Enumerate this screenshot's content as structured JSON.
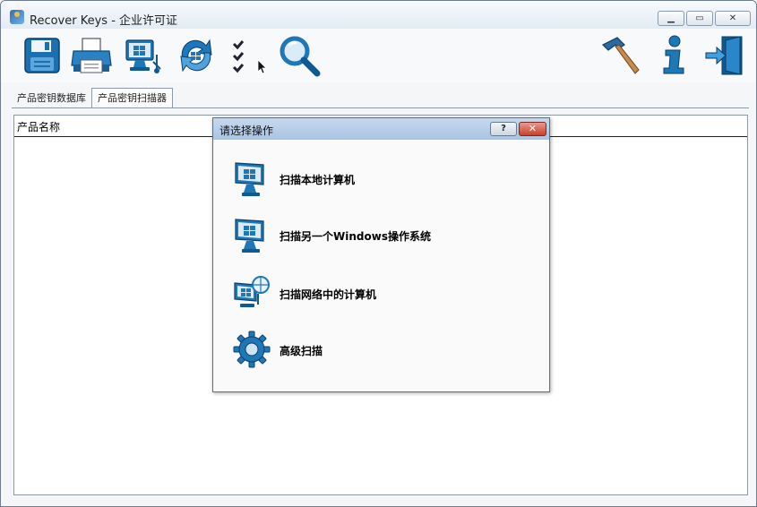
{
  "window": {
    "title": "Recover Keys - 企业许可证",
    "min_label": "▁",
    "max_label": "▭",
    "close_label": "✕"
  },
  "toolbar": {
    "icons": [
      "floppy-save-icon",
      "printer-icon",
      "network-computer-icon",
      "refresh-icon",
      "checklist-icon",
      "search-icon",
      "hammer-icon",
      "info-icon",
      "exit-door-icon"
    ]
  },
  "tabs": [
    {
      "label": "产品密钥数据库"
    },
    {
      "label": "产品密钥扫描器"
    }
  ],
  "active_tab": "产品密钥扫描器",
  "table": {
    "columns": [
      "产品名称"
    ]
  },
  "dialog": {
    "title": "请选择操作",
    "help_label": "?",
    "close_label": "✕",
    "options": [
      {
        "label": "扫描本地计算机",
        "icon": "computer-icon"
      },
      {
        "label": "扫描另一个Windows操作系统",
        "icon": "computer-icon"
      },
      {
        "label": "扫描网络中的计算机",
        "icon": "network-computer-icon"
      },
      {
        "label": "高级扫描",
        "icon": "gear-icon"
      }
    ]
  },
  "colors": {
    "icon_blue": "#1e78b8",
    "dialog_title": "#b8cfea",
    "close_red": "#c8402c"
  }
}
